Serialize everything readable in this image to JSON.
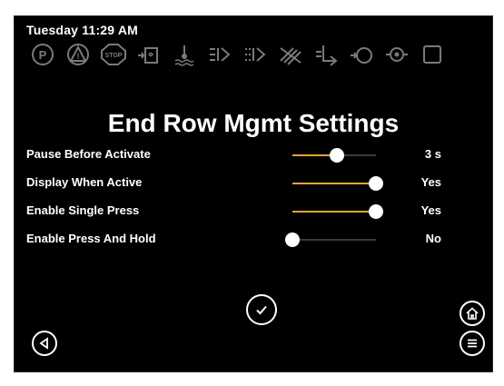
{
  "status": {
    "datetime": "Tuesday 11:29 AM"
  },
  "icons": [
    {
      "name": "parking-brake-icon",
      "text": "P"
    },
    {
      "name": "warning-icon",
      "text": "!"
    },
    {
      "name": "stop-icon",
      "text": "STOP"
    },
    {
      "name": "hydraulic-oil-icon",
      "text": ""
    },
    {
      "name": "coolant-temp-icon",
      "text": ""
    },
    {
      "name": "transmission-filter-icon",
      "text": ""
    },
    {
      "name": "hydraulic-filter-icon",
      "text": ""
    },
    {
      "name": "air-filter-icon",
      "text": ""
    },
    {
      "name": "fuel-level-icon",
      "text": ""
    },
    {
      "name": "oil-pressure-icon",
      "text": ""
    },
    {
      "name": "engine-oil-icon",
      "text": ""
    },
    {
      "name": "gps-icon",
      "text": ""
    }
  ],
  "page": {
    "title": "End Row Mgmt Settings"
  },
  "settings": [
    {
      "label": "Pause Before Activate",
      "value": "3 s",
      "level": 0.53
    },
    {
      "label": "Display When Active",
      "value": "Yes",
      "level": 1.0
    },
    {
      "label": "Enable Single Press",
      "value": "Yes",
      "level": 1.0
    },
    {
      "label": "Enable Press And Hold",
      "value": "No",
      "level": 0.0
    }
  ],
  "colors": {
    "accent": "#e4a23b",
    "background": "#000000",
    "text": "#ffffff",
    "inactive_icon": "#808080"
  },
  "buttons": {
    "confirm_icon": "checkmark-icon",
    "back_icon": "left-arrow-icon",
    "home_icon": "home-icon",
    "menu_icon": "menu-icon"
  }
}
